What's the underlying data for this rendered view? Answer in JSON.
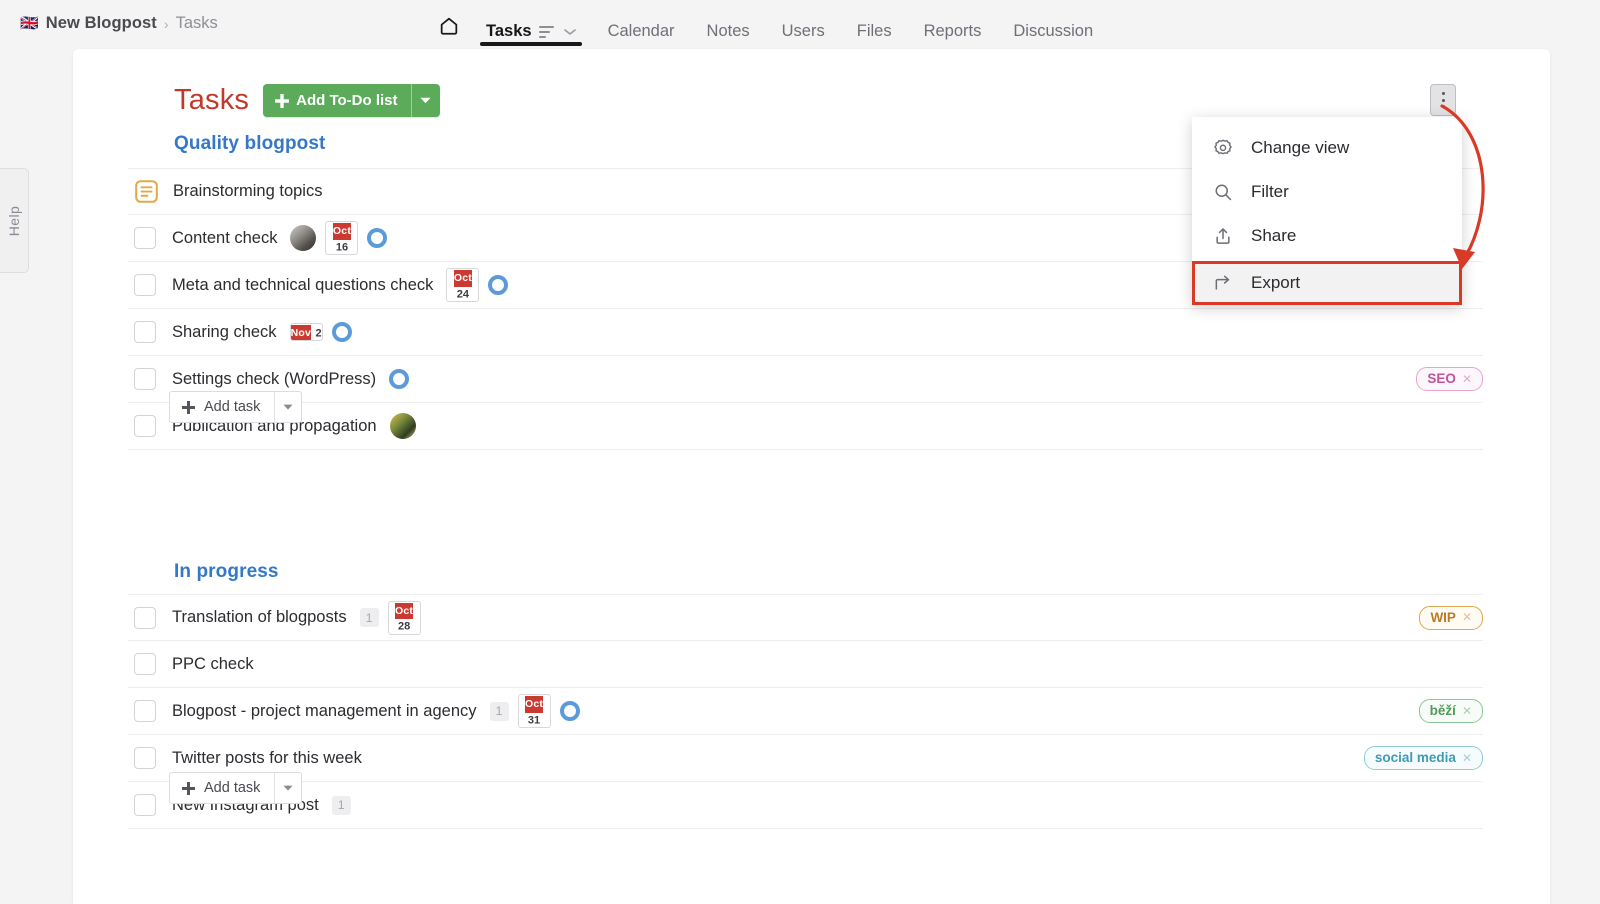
{
  "breadcrumb": {
    "flag": "🇬🇧",
    "project": "New Blogpost",
    "separator": "›",
    "current": "Tasks"
  },
  "nav": {
    "home_icon": "home-icon",
    "tabs": [
      {
        "label": "Tasks",
        "active": true,
        "has_sort_icon": true
      },
      {
        "label": "Calendar",
        "active": false
      },
      {
        "label": "Notes",
        "active": false
      },
      {
        "label": "Users",
        "active": false
      },
      {
        "label": "Files",
        "active": false
      },
      {
        "label": "Reports",
        "active": false
      },
      {
        "label": "Discussion",
        "active": false
      }
    ]
  },
  "help_tab": {
    "label": "Help"
  },
  "page": {
    "title": "Tasks",
    "title_color": "#c0392b",
    "add_list_button": "Add To-Do list",
    "add_task_button": "Add task"
  },
  "menu": {
    "trigger": "kebab-menu-button",
    "items": [
      {
        "label": "Change view",
        "icon": "settings-gear-icon",
        "selected": false
      },
      {
        "label": "Filter",
        "icon": "search-icon",
        "selected": false
      },
      {
        "label": "Share",
        "icon": "share-upload-icon",
        "selected": false
      },
      {
        "label": "Export",
        "icon": "export-arrow-icon",
        "selected": true
      }
    ],
    "highlight_color": "#d93a26"
  },
  "lists": [
    {
      "title": "Quality blogpost",
      "tasks": [
        {
          "name": "Brainstorming topics",
          "leading": "note-icon",
          "avatar": null,
          "date": null,
          "ring": false,
          "count": null,
          "tag": null
        },
        {
          "name": "Content check",
          "leading": "checkbox",
          "avatar": "avatar-person-1",
          "date": {
            "month": "Oct",
            "day": "16"
          },
          "ring": true,
          "count": null,
          "tag": null
        },
        {
          "name": "Meta and technical questions check",
          "leading": "checkbox",
          "avatar": null,
          "date": {
            "month": "Oct",
            "day": "24"
          },
          "ring": true,
          "count": null,
          "tag": null
        },
        {
          "name": "Sharing check",
          "leading": "checkbox",
          "avatar": null,
          "date": {
            "month": "Nov",
            "day": "2"
          },
          "ring": true,
          "count": null,
          "tag": null
        },
        {
          "name": "Settings check (WordPress)",
          "leading": "checkbox",
          "avatar": null,
          "date": null,
          "ring": true,
          "count": null,
          "tag": {
            "label": "SEO",
            "color": "#c2549c",
            "border": "#e3a8cf",
            "bg": "#fdf6fb"
          }
        },
        {
          "name": "Publication and propagation",
          "leading": "checkbox",
          "avatar": "avatar-person-2",
          "date": null,
          "ring": false,
          "count": null,
          "tag": null
        }
      ]
    },
    {
      "title": "In progress",
      "tasks": [
        {
          "name": "Translation of blogposts",
          "leading": "checkbox",
          "avatar": null,
          "date": {
            "month": "Oct",
            "day": "28"
          },
          "ring": false,
          "count": "1",
          "tag": {
            "label": "WIP",
            "color": "#c07a1e",
            "border": "#dba94f",
            "bg": "#fefbf4"
          }
        },
        {
          "name": "PPC check",
          "leading": "checkbox",
          "avatar": null,
          "date": null,
          "ring": false,
          "count": null,
          "tag": null
        },
        {
          "name": "Blogpost - project management in agency",
          "leading": "checkbox",
          "avatar": null,
          "date": {
            "month": "Oct",
            "day": "31"
          },
          "ring": true,
          "count": "1",
          "tag": {
            "label": "běží",
            "color": "#4f9c5a",
            "border": "#8cc697",
            "bg": "#f7fcf8"
          }
        },
        {
          "name": "Twitter posts for this week",
          "leading": "checkbox",
          "avatar": null,
          "date": null,
          "ring": false,
          "count": null,
          "tag": {
            "label": "social media",
            "color": "#3f9bb0",
            "border": "#92cbd8",
            "bg": "#f6fcfd"
          }
        },
        {
          "name": "New Instagram post",
          "leading": "checkbox",
          "avatar": null,
          "date": null,
          "ring": false,
          "count": "1",
          "tag": null
        }
      ]
    }
  ]
}
